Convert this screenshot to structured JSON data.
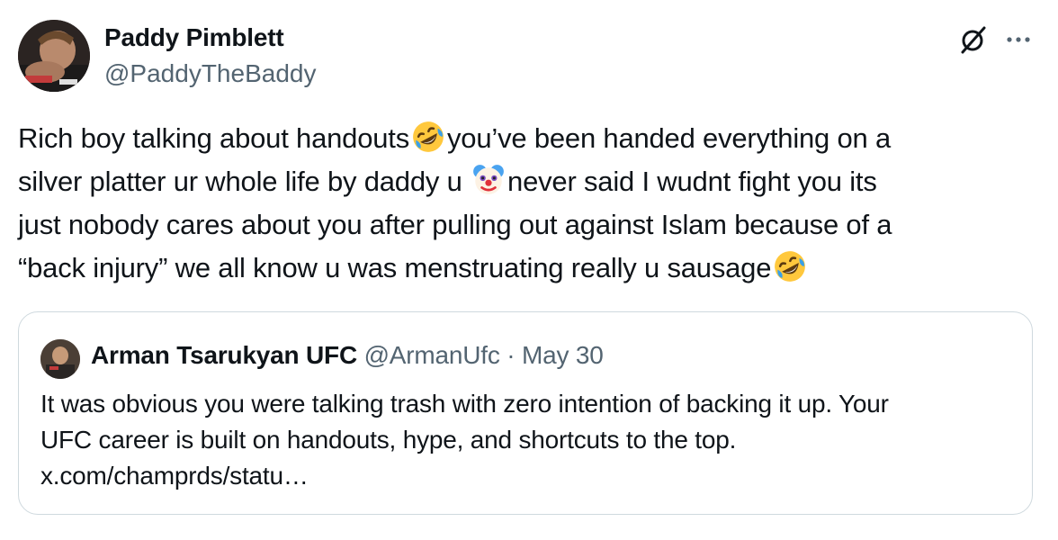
{
  "tweet": {
    "author": {
      "name": "Paddy Pimblett",
      "handle": "@PaddyTheBaddy"
    },
    "text_segments": {
      "l1a": "Rich boy talking about handouts",
      "l1b": "you’ve been handed everything on a",
      "l2a": "silver platter ur whole life by daddy u ",
      "l2b": "never said I wudnt fight you its",
      "l3": "just nobody cares about you after pulling out against Islam because of a",
      "l4": "“back injury” we all know u was menstruating really u sausage"
    },
    "emojis": [
      "rolling-on-floor-laughing",
      "clown-face",
      "rolling-on-floor-laughing"
    ],
    "actions": {
      "grok_icon": "grok-icon",
      "more_icon": "more-icon",
      "more_label": "···"
    }
  },
  "quoted_tweet": {
    "author_name": "Arman Tsarukyan UFC",
    "handle": "@ArmanUfc",
    "separator": "·",
    "date": "May 30",
    "text_lines": [
      "It was obvious you were talking trash with zero intention of backing it up. Your",
      "UFC career is built on handouts, hype, and shortcuts to the top.",
      "x.com/champrds/statu…"
    ]
  },
  "colors": {
    "text": "#0f1419",
    "secondary": "#536471",
    "border": "#cfd9de",
    "emoji_face": "#ffc83d",
    "tears": "#3aa0e8"
  }
}
